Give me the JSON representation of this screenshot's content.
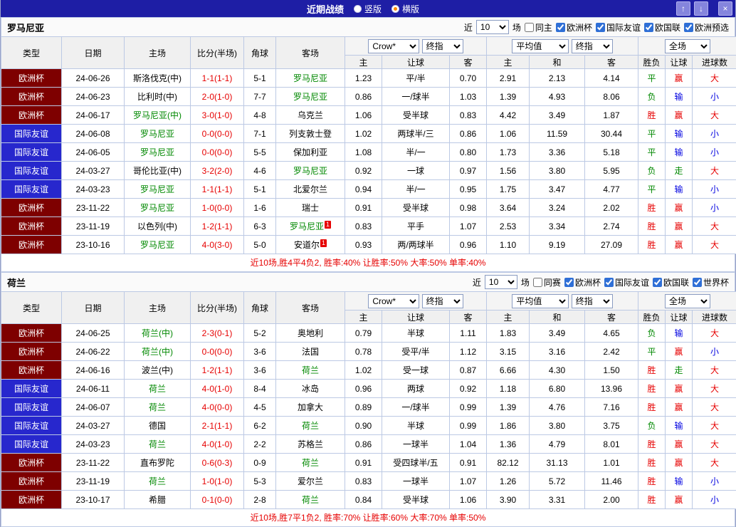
{
  "titlebar": {
    "title": "近期战绩",
    "layout_options": [
      {
        "label": "竖版",
        "selected": false
      },
      {
        "label": "横版",
        "selected": true
      }
    ],
    "up_button": "↑",
    "down_button": "↓",
    "close_button": "×"
  },
  "colors": {
    "titlebar_bg": "#1e1ea5",
    "cup_bg": "#7e0000",
    "friendly_bg": "#2727cd",
    "focus_team": "#008800",
    "win": "#e60000",
    "lose_blue": "#0000e0",
    "push_green": "#008800"
  },
  "sections": [
    {
      "team": "罗马尼亚",
      "filter": {
        "near": "近",
        "count": "10",
        "matches": "场",
        "same": {
          "label": "同主",
          "checked": false
        },
        "competitions": [
          {
            "label": "欧洲杯",
            "checked": true
          },
          {
            "label": "国际友谊",
            "checked": true
          },
          {
            "label": "欧国联",
            "checked": true
          },
          {
            "label": "欧洲预选",
            "checked": true
          }
        ]
      },
      "header": {
        "type": "类型",
        "date": "日期",
        "home": "主场",
        "score": "比分(半场)",
        "corner": "角球",
        "away": "客场",
        "ah_source": "Crow*",
        "ah_time": "终指",
        "eu_source": "平均值",
        "eu_time": "终指",
        "scope": "全场",
        "sub": [
          "主",
          "让球",
          "客",
          "主",
          "和",
          "客",
          "胜负",
          "让球",
          "进球数"
        ]
      },
      "rows": [
        {
          "comp": "欧洲杯",
          "comp_type": "cup",
          "date": "24-06-26",
          "home": {
            "name": "斯洛伐克(中)"
          },
          "score": "1-1(1-1)",
          "corner": "5-1",
          "away": {
            "name": "罗马尼亚",
            "focus": true
          },
          "ah": [
            "1.23",
            "平/半",
            "0.70"
          ],
          "eu": [
            "2.91",
            "2.13",
            "4.14"
          ],
          "result": {
            "text": "平",
            "c": "green"
          },
          "ah_result": {
            "text": "赢",
            "c": "red"
          },
          "ou_result": {
            "text": "大",
            "c": "red"
          }
        },
        {
          "comp": "欧洲杯",
          "comp_type": "cup",
          "date": "24-06-23",
          "home": {
            "name": "比利时(中)"
          },
          "score": "2-0(1-0)",
          "corner": "7-7",
          "away": {
            "name": "罗马尼亚",
            "focus": true
          },
          "ah": [
            "0.86",
            "一/球半",
            "1.03"
          ],
          "eu": [
            "1.39",
            "4.93",
            "8.06"
          ],
          "result": {
            "text": "负",
            "c": "green"
          },
          "ah_result": {
            "text": "输",
            "c": "blue"
          },
          "ou_result": {
            "text": "小",
            "c": "blue"
          }
        },
        {
          "comp": "欧洲杯",
          "comp_type": "cup",
          "date": "24-06-17",
          "home": {
            "name": "罗马尼亚(中)",
            "focus": true
          },
          "score": "3-0(1-0)",
          "corner": "4-8",
          "away": {
            "name": "乌克兰"
          },
          "ah": [
            "1.06",
            "受半球",
            "0.83"
          ],
          "eu": [
            "4.42",
            "3.49",
            "1.87"
          ],
          "result": {
            "text": "胜",
            "c": "red"
          },
          "ah_result": {
            "text": "赢",
            "c": "red"
          },
          "ou_result": {
            "text": "大",
            "c": "red"
          }
        },
        {
          "comp": "国际友谊",
          "comp_type": "friendly",
          "date": "24-06-08",
          "home": {
            "name": "罗马尼亚",
            "focus": true
          },
          "score": "0-0(0-0)",
          "corner": "7-1",
          "away": {
            "name": "列支敦士登"
          },
          "ah": [
            "1.02",
            "两球半/三",
            "0.86"
          ],
          "eu": [
            "1.06",
            "11.59",
            "30.44"
          ],
          "result": {
            "text": "平",
            "c": "green"
          },
          "ah_result": {
            "text": "输",
            "c": "blue"
          },
          "ou_result": {
            "text": "小",
            "c": "blue"
          }
        },
        {
          "comp": "国际友谊",
          "comp_type": "friendly",
          "date": "24-06-05",
          "home": {
            "name": "罗马尼亚",
            "focus": true
          },
          "score": "0-0(0-0)",
          "corner": "5-5",
          "away": {
            "name": "保加利亚"
          },
          "ah": [
            "1.08",
            "半/一",
            "0.80"
          ],
          "eu": [
            "1.73",
            "3.36",
            "5.18"
          ],
          "result": {
            "text": "平",
            "c": "green"
          },
          "ah_result": {
            "text": "输",
            "c": "blue"
          },
          "ou_result": {
            "text": "小",
            "c": "blue"
          }
        },
        {
          "comp": "国际友谊",
          "comp_type": "friendly",
          "date": "24-03-27",
          "home": {
            "name": "哥伦比亚(中)"
          },
          "score": "3-2(2-0)",
          "corner": "4-6",
          "away": {
            "name": "罗马尼亚",
            "focus": true
          },
          "ah": [
            "0.92",
            "一球",
            "0.97"
          ],
          "eu": [
            "1.56",
            "3.80",
            "5.95"
          ],
          "result": {
            "text": "负",
            "c": "green"
          },
          "ah_result": {
            "text": "走",
            "c": "green"
          },
          "ou_result": {
            "text": "大",
            "c": "red"
          }
        },
        {
          "comp": "国际友谊",
          "comp_type": "friendly",
          "date": "24-03-23",
          "home": {
            "name": "罗马尼亚",
            "focus": true
          },
          "score": "1-1(1-1)",
          "corner": "5-1",
          "away": {
            "name": "北爱尔兰"
          },
          "ah": [
            "0.94",
            "半/一",
            "0.95"
          ],
          "eu": [
            "1.75",
            "3.47",
            "4.77"
          ],
          "result": {
            "text": "平",
            "c": "green"
          },
          "ah_result": {
            "text": "输",
            "c": "blue"
          },
          "ou_result": {
            "text": "小",
            "c": "blue"
          }
        },
        {
          "comp": "欧洲杯",
          "comp_type": "cup",
          "date": "23-11-22",
          "home": {
            "name": "罗马尼亚",
            "focus": true
          },
          "score": "1-0(0-0)",
          "corner": "1-6",
          "away": {
            "name": "瑞士"
          },
          "ah": [
            "0.91",
            "受半球",
            "0.98"
          ],
          "eu": [
            "3.64",
            "3.24",
            "2.02"
          ],
          "result": {
            "text": "胜",
            "c": "red"
          },
          "ah_result": {
            "text": "赢",
            "c": "red"
          },
          "ou_result": {
            "text": "小",
            "c": "blue"
          }
        },
        {
          "comp": "欧洲杯",
          "comp_type": "cup",
          "date": "23-11-19",
          "home": {
            "name": "以色列(中)"
          },
          "score": "1-2(1-1)",
          "corner": "6-3",
          "away": {
            "name": "罗马尼亚",
            "focus": true,
            "badge": "1"
          },
          "ah": [
            "0.83",
            "平手",
            "1.07"
          ],
          "eu": [
            "2.53",
            "3.34",
            "2.74"
          ],
          "result": {
            "text": "胜",
            "c": "red"
          },
          "ah_result": {
            "text": "赢",
            "c": "red"
          },
          "ou_result": {
            "text": "大",
            "c": "red"
          }
        },
        {
          "comp": "欧洲杯",
          "comp_type": "cup",
          "date": "23-10-16",
          "home": {
            "name": "罗马尼亚",
            "focus": true
          },
          "score": "4-0(3-0)",
          "corner": "5-0",
          "away": {
            "name": "安道尔",
            "badge": "1"
          },
          "ah": [
            "0.93",
            "两/两球半",
            "0.96"
          ],
          "eu": [
            "1.10",
            "9.19",
            "27.09"
          ],
          "result": {
            "text": "胜",
            "c": "red"
          },
          "ah_result": {
            "text": "赢",
            "c": "red"
          },
          "ou_result": {
            "text": "大",
            "c": "red"
          }
        }
      ],
      "summary": "近10场,胜4平4负2, 胜率:40% 让胜率:50% 大率:50% 单率:40%"
    },
    {
      "team": "荷兰",
      "filter": {
        "near": "近",
        "count": "10",
        "matches": "场",
        "same": {
          "label": "同赛",
          "checked": false
        },
        "competitions": [
          {
            "label": "欧洲杯",
            "checked": true
          },
          {
            "label": "国际友谊",
            "checked": true
          },
          {
            "label": "欧国联",
            "checked": true
          },
          {
            "label": "世界杯",
            "checked": true
          }
        ]
      },
      "header": {
        "type": "类型",
        "date": "日期",
        "home": "主场",
        "score": "比分(半场)",
        "corner": "角球",
        "away": "客场",
        "ah_source": "Crow*",
        "ah_time": "终指",
        "eu_source": "平均值",
        "eu_time": "终指",
        "scope": "全场",
        "sub": [
          "主",
          "让球",
          "客",
          "主",
          "和",
          "客",
          "胜负",
          "让球",
          "进球数"
        ]
      },
      "rows": [
        {
          "comp": "欧洲杯",
          "comp_type": "cup",
          "date": "24-06-25",
          "home": {
            "name": "荷兰(中)",
            "focus": true
          },
          "score": "2-3(0-1)",
          "corner": "5-2",
          "away": {
            "name": "奥地利"
          },
          "ah": [
            "0.79",
            "半球",
            "1.11"
          ],
          "eu": [
            "1.83",
            "3.49",
            "4.65"
          ],
          "result": {
            "text": "负",
            "c": "green"
          },
          "ah_result": {
            "text": "输",
            "c": "blue"
          },
          "ou_result": {
            "text": "大",
            "c": "red"
          }
        },
        {
          "comp": "欧洲杯",
          "comp_type": "cup",
          "date": "24-06-22",
          "home": {
            "name": "荷兰(中)",
            "focus": true
          },
          "score": "0-0(0-0)",
          "corner": "3-6",
          "away": {
            "name": "法国"
          },
          "ah": [
            "0.78",
            "受平/半",
            "1.12"
          ],
          "eu": [
            "3.15",
            "3.16",
            "2.42"
          ],
          "result": {
            "text": "平",
            "c": "green"
          },
          "ah_result": {
            "text": "赢",
            "c": "red"
          },
          "ou_result": {
            "text": "小",
            "c": "blue"
          }
        },
        {
          "comp": "欧洲杯",
          "comp_type": "cup",
          "date": "24-06-16",
          "home": {
            "name": "波兰(中)"
          },
          "score": "1-2(1-1)",
          "corner": "3-6",
          "away": {
            "name": "荷兰",
            "focus": true
          },
          "ah": [
            "1.02",
            "受一球",
            "0.87"
          ],
          "eu": [
            "6.66",
            "4.30",
            "1.50"
          ],
          "result": {
            "text": "胜",
            "c": "red"
          },
          "ah_result": {
            "text": "走",
            "c": "green"
          },
          "ou_result": {
            "text": "大",
            "c": "red"
          }
        },
        {
          "comp": "国际友谊",
          "comp_type": "friendly",
          "date": "24-06-11",
          "home": {
            "name": "荷兰",
            "focus": true
          },
          "score": "4-0(1-0)",
          "corner": "8-4",
          "away": {
            "name": "冰岛"
          },
          "ah": [
            "0.96",
            "两球",
            "0.92"
          ],
          "eu": [
            "1.18",
            "6.80",
            "13.96"
          ],
          "result": {
            "text": "胜",
            "c": "red"
          },
          "ah_result": {
            "text": "赢",
            "c": "red"
          },
          "ou_result": {
            "text": "大",
            "c": "red"
          }
        },
        {
          "comp": "国际友谊",
          "comp_type": "friendly",
          "date": "24-06-07",
          "home": {
            "name": "荷兰",
            "focus": true
          },
          "score": "4-0(0-0)",
          "corner": "4-5",
          "away": {
            "name": "加拿大"
          },
          "ah": [
            "0.89",
            "一/球半",
            "0.99"
          ],
          "eu": [
            "1.39",
            "4.76",
            "7.16"
          ],
          "result": {
            "text": "胜",
            "c": "red"
          },
          "ah_result": {
            "text": "赢",
            "c": "red"
          },
          "ou_result": {
            "text": "大",
            "c": "red"
          }
        },
        {
          "comp": "国际友谊",
          "comp_type": "friendly",
          "date": "24-03-27",
          "home": {
            "name": "德国"
          },
          "score": "2-1(1-1)",
          "corner": "6-2",
          "away": {
            "name": "荷兰",
            "focus": true
          },
          "ah": [
            "0.90",
            "半球",
            "0.99"
          ],
          "eu": [
            "1.86",
            "3.80",
            "3.75"
          ],
          "result": {
            "text": "负",
            "c": "green"
          },
          "ah_result": {
            "text": "输",
            "c": "blue"
          },
          "ou_result": {
            "text": "大",
            "c": "red"
          }
        },
        {
          "comp": "国际友谊",
          "comp_type": "friendly",
          "date": "24-03-23",
          "home": {
            "name": "荷兰",
            "focus": true
          },
          "score": "4-0(1-0)",
          "corner": "2-2",
          "away": {
            "name": "苏格兰"
          },
          "ah": [
            "0.86",
            "一球半",
            "1.04"
          ],
          "eu": [
            "1.36",
            "4.79",
            "8.01"
          ],
          "result": {
            "text": "胜",
            "c": "red"
          },
          "ah_result": {
            "text": "赢",
            "c": "red"
          },
          "ou_result": {
            "text": "大",
            "c": "red"
          }
        },
        {
          "comp": "欧洲杯",
          "comp_type": "cup",
          "date": "23-11-22",
          "home": {
            "name": "直布罗陀"
          },
          "score": "0-6(0-3)",
          "corner": "0-9",
          "away": {
            "name": "荷兰",
            "focus": true
          },
          "ah": [
            "0.91",
            "受四球半/五",
            "0.91"
          ],
          "eu": [
            "82.12",
            "31.13",
            "1.01"
          ],
          "result": {
            "text": "胜",
            "c": "red"
          },
          "ah_result": {
            "text": "赢",
            "c": "red"
          },
          "ou_result": {
            "text": "大",
            "c": "red"
          }
        },
        {
          "comp": "欧洲杯",
          "comp_type": "cup",
          "date": "23-11-19",
          "home": {
            "name": "荷兰",
            "focus": true
          },
          "score": "1-0(1-0)",
          "corner": "5-3",
          "away": {
            "name": "爱尔兰"
          },
          "ah": [
            "0.83",
            "一球半",
            "1.07"
          ],
          "eu": [
            "1.26",
            "5.72",
            "11.46"
          ],
          "result": {
            "text": "胜",
            "c": "red"
          },
          "ah_result": {
            "text": "输",
            "c": "blue"
          },
          "ou_result": {
            "text": "小",
            "c": "blue"
          }
        },
        {
          "comp": "欧洲杯",
          "comp_type": "cup",
          "date": "23-10-17",
          "home": {
            "name": "希腊"
          },
          "score": "0-1(0-0)",
          "corner": "2-8",
          "away": {
            "name": "荷兰",
            "focus": true
          },
          "ah": [
            "0.84",
            "受半球",
            "1.06"
          ],
          "eu": [
            "3.90",
            "3.31",
            "2.00"
          ],
          "result": {
            "text": "胜",
            "c": "red"
          },
          "ah_result": {
            "text": "赢",
            "c": "red"
          },
          "ou_result": {
            "text": "小",
            "c": "blue"
          }
        }
      ],
      "summary": "近10场,胜7平1负2, 胜率:70% 让胜率:60% 大率:70% 单率:50%"
    }
  ]
}
